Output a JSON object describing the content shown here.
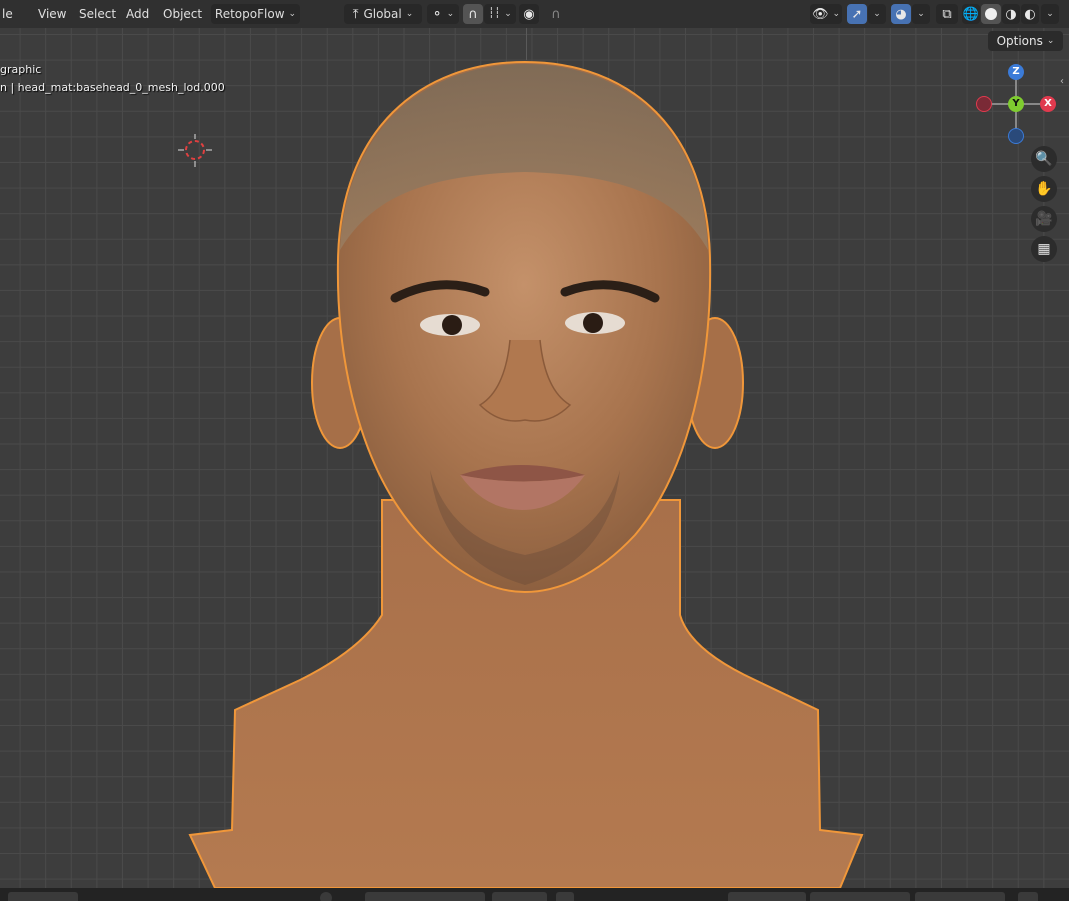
{
  "header": {
    "menus": [
      "le",
      "View",
      "Select",
      "Add",
      "Object"
    ],
    "addon_dropdown": "RetopoFlow",
    "transform_orientation": "Global",
    "options_label": "Options"
  },
  "overlay": {
    "view_name": "graphic",
    "object_info": "n | head_mat:basehead_0_mesh_lod.000"
  },
  "gizmo": {
    "z": "Z",
    "y": "Y",
    "x": "X"
  },
  "icons": {
    "view_toggle": "eye-icon",
    "gizmo_toggle": "gizmo-icon",
    "overlay_toggle": "overlay-icon",
    "xray": "xray-icon",
    "shading_wire": "wireframe-icon",
    "shading_solid": "solid-icon",
    "shading_material": "material-icon",
    "shading_render": "rendered-icon",
    "zoom": "zoom-icon",
    "pan": "hand-icon",
    "camera": "camera-icon",
    "ortho": "grid-icon"
  },
  "colors": {
    "selection_outline": "#f0973a",
    "skin": "#b07a52",
    "accent": "#4772b3"
  }
}
